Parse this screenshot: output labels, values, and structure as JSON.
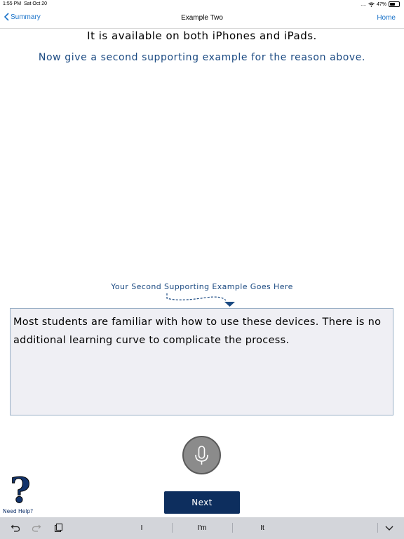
{
  "status_bar": {
    "time": "1:55 PM",
    "date": "Sat Oct 20",
    "signal": "....",
    "battery_percent": "47%",
    "battery_level": 0.47
  },
  "nav": {
    "back_label": "Summary",
    "title": "Example Two",
    "home_label": "Home"
  },
  "reason_text": "It is available on both iPhones and iPads.",
  "instruction_text": "Now give a second supporting example for the reason above.",
  "goes_here_label": "Your Second Supporting Example Goes Here",
  "answer_text": "Most students are familiar with how to use these devices. There is no additional learning curve to complicate the process.",
  "help_label": "Need Help?",
  "help_mark": "?",
  "next_label": "Next",
  "keyboard": {
    "suggestions": [
      "I",
      "I'm",
      "It"
    ]
  },
  "colors": {
    "accent": "#1b4a82",
    "button": "#0d2e5e",
    "link": "#1a73c9",
    "box": "#efeff4"
  }
}
